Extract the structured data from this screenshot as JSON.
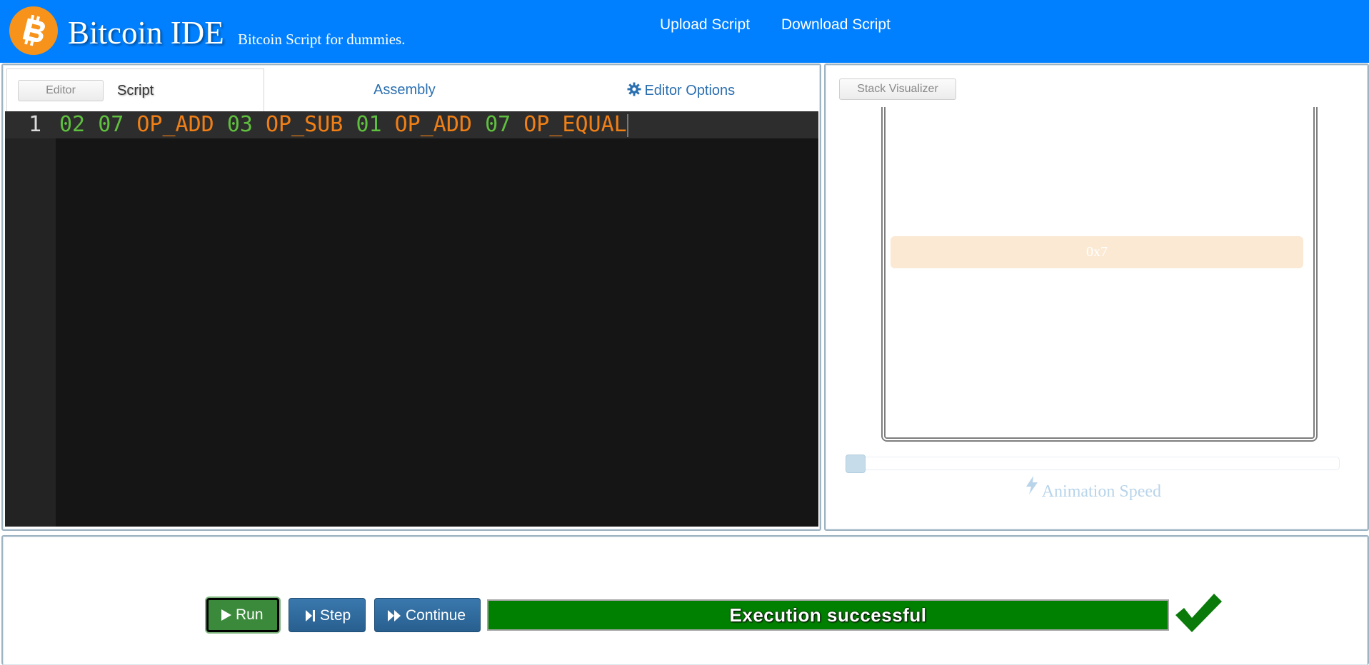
{
  "header": {
    "title": "Bitcoin IDE",
    "tagline": "Bitcoin Script for dummies.",
    "nav": {
      "upload": "Upload Script",
      "download": "Download Script"
    }
  },
  "editor": {
    "panel_badge": "Editor",
    "tabs": {
      "script": "Script",
      "assembly": "Assembly",
      "options": "Editor Options"
    },
    "line_number": "1",
    "tokens": [
      {
        "text": "02",
        "kind": "num"
      },
      {
        "text": "07",
        "kind": "num"
      },
      {
        "text": "OP_ADD",
        "kind": "op"
      },
      {
        "text": "03",
        "kind": "num"
      },
      {
        "text": "OP_SUB",
        "kind": "op"
      },
      {
        "text": "01",
        "kind": "num"
      },
      {
        "text": "OP_ADD",
        "kind": "op"
      },
      {
        "text": "07",
        "kind": "num"
      },
      {
        "text": "OP_EQUAL",
        "kind": "op"
      }
    ]
  },
  "visualizer": {
    "panel_badge": "Stack Visualizer",
    "stack_items": [
      "0x7"
    ],
    "speed_label": "Animation Speed",
    "speed_value": 0
  },
  "execution": {
    "run_label": "Run",
    "step_label": "Step",
    "continue_label": "Continue",
    "status_text": "Execution successful",
    "status_color": "#008000"
  },
  "colors": {
    "header_bg": "#0080ff",
    "logo": "#f7931a",
    "number_token": "#5fbf3f",
    "opcode_token": "#f07f15"
  }
}
